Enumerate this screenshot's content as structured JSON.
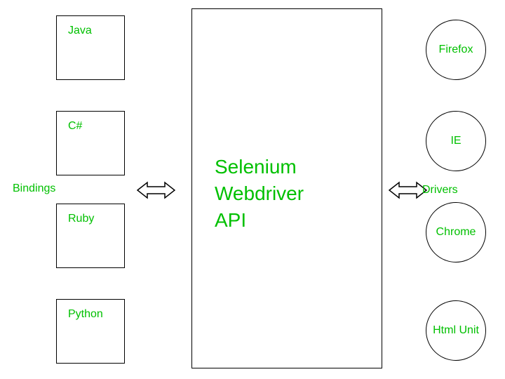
{
  "bindings": {
    "label": "Bindings",
    "items": [
      "Java",
      "C#",
      "Ruby",
      "Python"
    ]
  },
  "center": {
    "line1": "Selenium",
    "line2": "Webdriver",
    "line3": "API"
  },
  "drivers": {
    "label": "Drivers",
    "items": [
      "Firefox",
      "IE",
      "Chrome",
      "Html Unit"
    ]
  }
}
